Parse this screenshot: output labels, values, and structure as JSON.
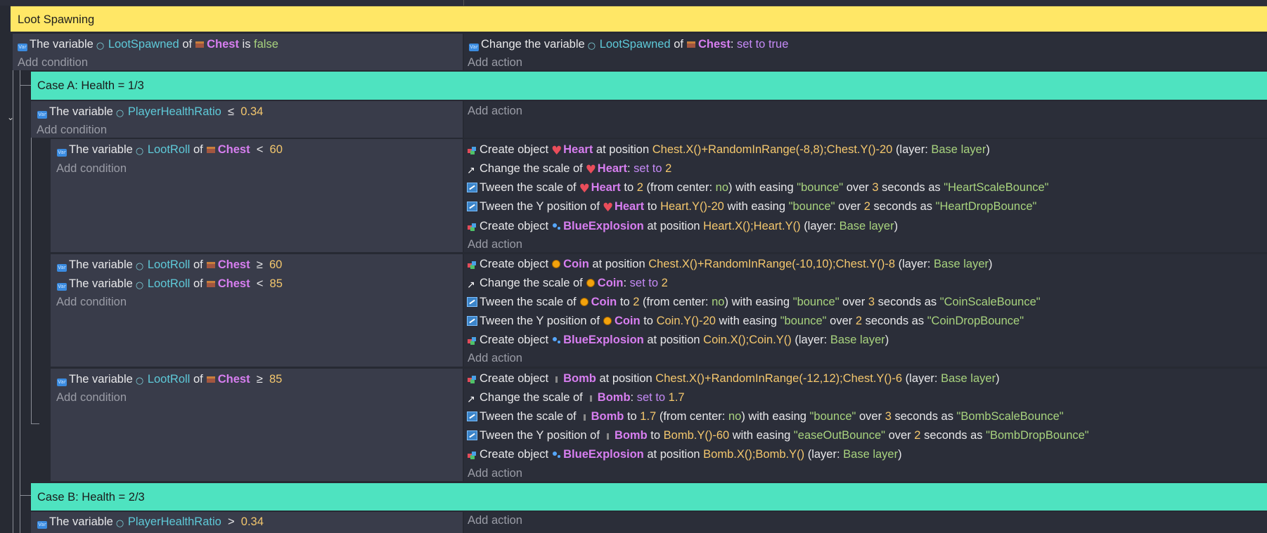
{
  "group": {
    "title": "Loot Spawning"
  },
  "root_event": {
    "condition": {
      "prefix": "The variable",
      "variable": "LootSpawned",
      "of": "of",
      "object": "Chest",
      "rest": "is",
      "value": "false"
    },
    "add_condition": "Add condition",
    "action": {
      "prefix": "Change the variable",
      "variable": "LootSpawned",
      "of": "of",
      "object": "Chest",
      "sep": ":",
      "value": "set to true"
    },
    "add_action": "Add action"
  },
  "case_a": {
    "title": "Case A: Health = 1/3",
    "condition": {
      "prefix": "The variable",
      "variable": "PlayerHealthRatio",
      "op": "≤",
      "value": "0.34"
    },
    "add_condition": "Add condition",
    "add_action": "Add action",
    "subevents": [
      {
        "conditions": [
          {
            "prefix": "The variable",
            "variable": "LootRoll",
            "of": "of",
            "object": "Chest",
            "op": "<",
            "value": "60"
          }
        ],
        "add_condition": "Add condition",
        "actions": [
          "Create object ❤ Heart at position Chest.X()+RandomInRange(-8,8);Chest.Y()-20 (layer: Base layer)"
        ],
        "add_action": "Add action"
      },
      {
        "conditions": [
          {
            "prefix": "The variable",
            "variable": "LootRoll",
            "of": "of",
            "object": "Chest",
            "op": "≥",
            "value": "60"
          },
          {
            "prefix": "The variable",
            "variable": "LootRoll",
            "of": "of",
            "object": "Chest",
            "op": "<",
            "value": "85"
          }
        ],
        "add_condition": "Add condition",
        "add_action": "Add action"
      },
      {
        "conditions": [
          {
            "prefix": "The variable",
            "variable": "LootRoll",
            "of": "of",
            "object": "Chest",
            "op": "≥",
            "value": "85"
          }
        ],
        "add_condition": "Add condition",
        "add_action": "Add action"
      }
    ]
  },
  "heart_actions": {
    "a1": {
      "t1": "Create object",
      "obj": "Heart",
      "t2": "at position",
      "expr": "Chest.X()+RandomInRange(-8,8);Chest.Y()-20",
      "t3": "(layer:",
      "layer": "Base layer",
      "t4": ")"
    },
    "a2": {
      "t1": "Change the scale of",
      "obj": "Heart",
      "sep": ":",
      "val1": "set to",
      "val2": "2"
    },
    "a3": {
      "t1": "Tween the scale of",
      "obj": "Heart",
      "t2": "to",
      "n1": "2",
      "t3": "(from center:",
      "c": "no",
      "t4": ") with easing",
      "e": "\"bounce\"",
      "t5": "over",
      "n2": "3",
      "t6": "seconds as",
      "name": "\"HeartScaleBounce\""
    },
    "a4": {
      "t1": "Tween the Y position of",
      "obj": "Heart",
      "t2": "to",
      "expr": "Heart.Y()-20",
      "t3": "with easing",
      "e": "\"bounce\"",
      "t4": "over",
      "n": "2",
      "t5": "seconds as",
      "name": "\"HeartDropBounce\""
    },
    "a5": {
      "t1": "Create object",
      "obj": "BlueExplosion",
      "t2": "at position",
      "expr": "Heart.X();Heart.Y()",
      "t3": "(layer:",
      "layer": "Base layer",
      "t4": ")"
    }
  },
  "coin_actions": {
    "a1": {
      "t1": "Create object",
      "obj": "Coin",
      "t2": "at position",
      "expr": "Chest.X()+RandomInRange(-10,10);Chest.Y()-8",
      "t3": "(layer:",
      "layer": "Base layer",
      "t4": ")"
    },
    "a2": {
      "t1": "Change the scale of",
      "obj": "Coin",
      "sep": ":",
      "val1": "set to",
      "val2": "2"
    },
    "a3": {
      "t1": "Tween the scale of",
      "obj": "Coin",
      "t2": "to",
      "n1": "2",
      "t3": "(from center:",
      "c": "no",
      "t4": ") with easing",
      "e": "\"bounce\"",
      "t5": "over",
      "n2": "3",
      "t6": "seconds as",
      "name": "\"CoinScaleBounce\""
    },
    "a4": {
      "t1": "Tween the Y position of",
      "obj": "Coin",
      "t2": "to",
      "expr": "Coin.Y()-20",
      "t3": "with easing",
      "e": "\"bounce\"",
      "t4": "over",
      "n": "2",
      "t5": "seconds as",
      "name": "\"CoinDropBounce\""
    },
    "a5": {
      "t1": "Create object",
      "obj": "BlueExplosion",
      "t2": "at position",
      "expr": "Coin.X();Coin.Y()",
      "t3": "(layer:",
      "layer": "Base layer",
      "t4": ")"
    }
  },
  "bomb_actions": {
    "a1": {
      "t1": "Create object",
      "obj": "Bomb",
      "t2": "at position",
      "expr": "Chest.X()+RandomInRange(-12,12);Chest.Y()-6",
      "t3": "(layer:",
      "layer": "Base layer",
      "t4": ")"
    },
    "a2": {
      "t1": "Change the scale of",
      "obj": "Bomb",
      "sep": ":",
      "val1": "set to",
      "val2": "1.7"
    },
    "a3": {
      "t1": "Tween the scale of",
      "obj": "Bomb",
      "t2": "to",
      "n1": "1.7",
      "t3": "(from center:",
      "c": "no",
      "t4": ") with easing",
      "e": "\"bounce\"",
      "t5": "over",
      "n2": "3",
      "t6": "seconds as",
      "name": "\"BombScaleBounce\""
    },
    "a4": {
      "t1": "Tween the Y position of",
      "obj": "Bomb",
      "t2": "to",
      "expr": "Bomb.Y()-60",
      "t3": "with easing",
      "e": "\"easeOutBounce\"",
      "t4": "over",
      "n": "2",
      "t5": "seconds as",
      "name": "\"BombDropBounce\""
    },
    "a5": {
      "t1": "Create object",
      "obj": "BlueExplosion",
      "t2": "at position",
      "expr": "Bomb.X();Bomb.Y()",
      "t3": "(layer:",
      "layer": "Base layer",
      "t4": ")"
    }
  },
  "case_b": {
    "title": "Case B: Health = 2/3",
    "condition": {
      "prefix": "The variable",
      "variable": "PlayerHealthRatio",
      "op": ">",
      "value": "0.34"
    },
    "add_action": "Add action"
  },
  "icons": {
    "variable": "variable-icon",
    "scene_var": "scene-variable-icon",
    "chest": "chest-icon",
    "heart": "heart-icon",
    "coin": "coin-icon",
    "bomb": "bomb-icon",
    "blue": "blue-explosion-icon",
    "create": "create-object-icon",
    "scale": "scale-icon",
    "tween": "tween-icon",
    "collapse": "chevron-down-icon"
  },
  "colors": {
    "group_bar": "#ffe766",
    "case_bar": "#4ee3c0",
    "condition_bg": "#393c4a",
    "action_bg": "#2b2e39",
    "variable": "#5ec9d8",
    "object": "#d77ef0",
    "number": "#f4c76d",
    "string": "#a8d37e"
  }
}
